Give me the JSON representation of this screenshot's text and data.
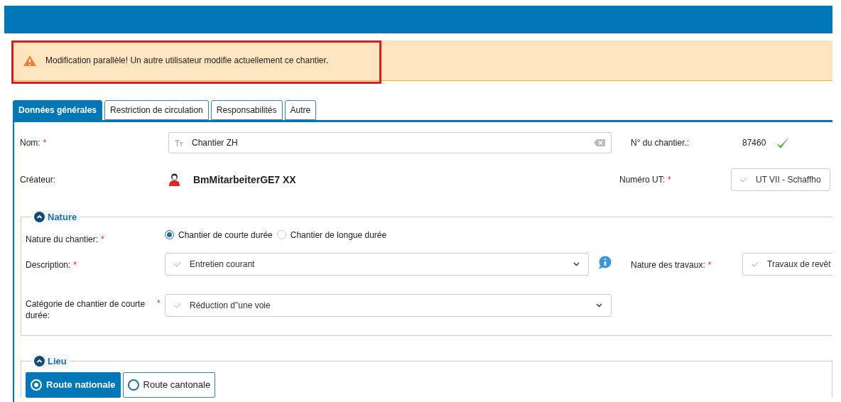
{
  "alert": {
    "message": "Modification parallèle! Un autre utilisateur modifie actuellement ce chantier.",
    "highlighted": true
  },
  "tabs": [
    {
      "label": "Données générales",
      "selected": true
    },
    {
      "label": "Restriction de circulation",
      "selected": false
    },
    {
      "label": "Responsabilités",
      "selected": false
    },
    {
      "label": "Autre",
      "selected": false
    }
  ],
  "required_mark": "*",
  "general": {
    "name": {
      "label": "Nom:",
      "required": true,
      "value": "Chantier ZH"
    },
    "number": {
      "label": "N° du chantier.:",
      "required": false,
      "value": "87460",
      "valid": true
    },
    "creator": {
      "label": "Créateur:",
      "required": false,
      "value": "BmMitarbeiterGE7 XX"
    },
    "ut": {
      "label": "Numéro UT:",
      "required": true,
      "value": "UT VII - Schaffho"
    }
  },
  "nature": {
    "title": "Nature",
    "expanded": true,
    "kind_label": "Nature du chantier:",
    "kind_required": true,
    "options": [
      {
        "label": "Chantier de courte durée",
        "selected": true
      },
      {
        "label": "Chantier de longue durée",
        "selected": false
      }
    ],
    "description": {
      "label": "Description:",
      "required": true,
      "value": "Entretien courant"
    },
    "works": {
      "label": "Nature des travaux:",
      "required": true,
      "value": "Travaux de revêt"
    },
    "category": {
      "label": "Catégorie de chantier de courte durée:",
      "required": true,
      "value": "Réduction d\"une voie"
    }
  },
  "lieu": {
    "title": "Lieu",
    "expanded": true,
    "options": [
      {
        "label": "Route nationale",
        "selected": true
      },
      {
        "label": "Route cantonale",
        "selected": false
      }
    ]
  }
}
